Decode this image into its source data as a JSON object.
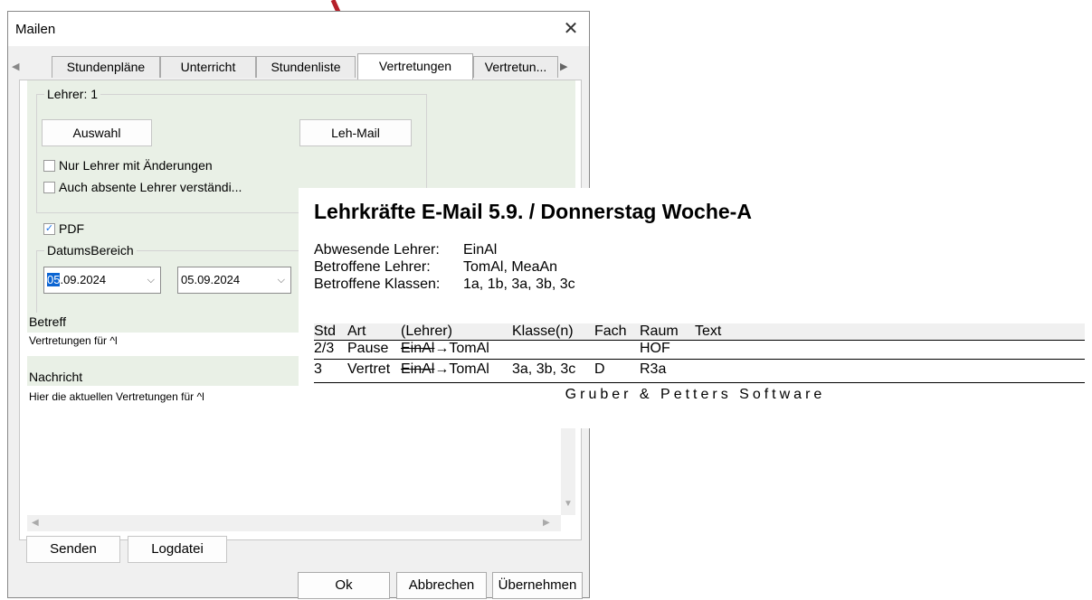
{
  "window": {
    "title": "Mailen",
    "close_glyph": "✕"
  },
  "tabs": {
    "scroll_left": "◀",
    "scroll_right": "▶",
    "items": [
      {
        "label": "Stundenpläne"
      },
      {
        "label": "Unterricht"
      },
      {
        "label": "Stundenliste"
      },
      {
        "label": "Vertretungen"
      },
      {
        "label": "Vertretun..."
      }
    ],
    "active": "Vertretungen"
  },
  "recipients": {
    "group_label": "Lehrer: 1",
    "select_button": "Auswahl",
    "mail_button": "Leh-Mail",
    "only_changed": {
      "label": "Nur Lehrer mit Änderungen",
      "checked": false
    },
    "notify_absent": {
      "label": "Auch absente Lehrer verständi...",
      "checked": false
    }
  },
  "options": {
    "pdf": {
      "label": "PDF",
      "checked": true,
      "check_glyph": "✓"
    }
  },
  "date_range": {
    "label": "DatumsBereich",
    "from_selected": "05",
    "from_rest": ".09.2024",
    "to": "05.09.2024",
    "arrow_glyph": "⌵"
  },
  "subject": {
    "label": "Betreff",
    "value": "Vertretungen für ^l"
  },
  "message": {
    "label": "Nachricht",
    "value": "Hier die aktuellen Vertretungen für ^l",
    "scroll_down": "▼",
    "scroll_left": "◀",
    "scroll_right": "▶"
  },
  "actions": {
    "send": "Senden",
    "log": "Logdatei"
  },
  "dialog_buttons": {
    "ok": "Ok",
    "cancel": "Abbrechen",
    "apply": "Übernehmen"
  },
  "preview": {
    "title": "Lehrkräfte E-Mail  5.9. / Donnerstag Woche-A",
    "info": [
      {
        "key": "Abwesende Lehrer:",
        "value": "EinAl"
      },
      {
        "key": "Betroffene Lehrer:",
        "value": "TomAl, MeaAn"
      },
      {
        "key": "Betroffene Klassen:",
        "value": "1a, 1b, 3a, 3b, 3c"
      }
    ],
    "columns": [
      "Std",
      "Art",
      "(Lehrer)",
      "Klasse(n)",
      "Fach",
      "Raum",
      "Text"
    ],
    "rows": [
      {
        "std": "2/3",
        "art": "Pause",
        "from": "EinAl",
        "to": "→TomAl",
        "klassen": "",
        "fach": "",
        "raum": "HOF",
        "text": ""
      },
      {
        "std": "3",
        "art": "Vertret",
        "from": "EinAl",
        "to": "→TomAl",
        "klassen": "3a, 3b, 3c",
        "fach": "D",
        "raum": "R3a",
        "text": ""
      }
    ],
    "footer": "Gruber & Petters Software"
  },
  "colors": {
    "arrow": "#b5202a",
    "panel": "#e9f0e6",
    "selection": "#0a64d2"
  }
}
